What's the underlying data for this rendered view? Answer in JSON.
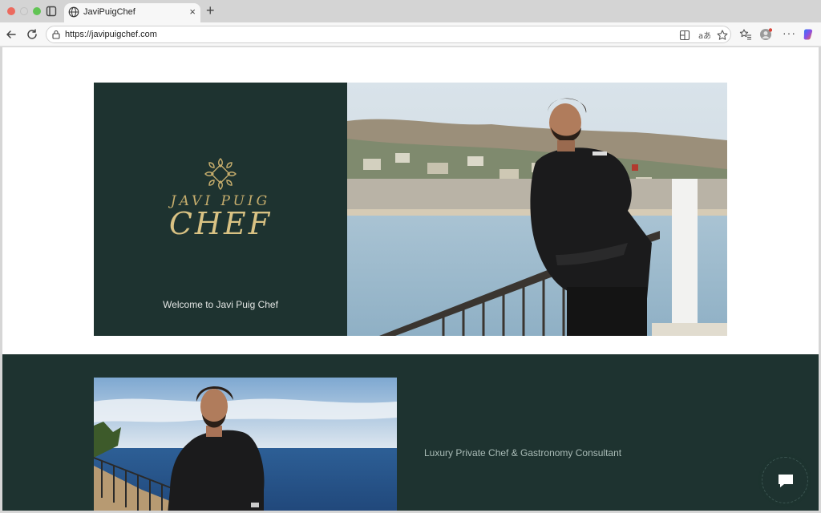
{
  "browser": {
    "tab_title": "JaviPuigChef",
    "url": "https://javipuigchef.com",
    "close_glyph": "×",
    "newtab_glyph": "+",
    "more_glyph": "···"
  },
  "hero": {
    "logo_line1": "JAVI PUIG",
    "logo_line2": "CHEF",
    "welcome": "Welcome to Javi Puig Chef"
  },
  "about": {
    "tagline": "Luxury Private Chef & Gastronomy Consultant"
  },
  "colors": {
    "brand_green": "#1e3330",
    "gold": "#c7ae6d"
  },
  "icons": [
    "globe-icon",
    "back-icon",
    "reload-icon",
    "lock-icon",
    "split-screen-icon",
    "translate-icon",
    "star-icon",
    "favorites-icon",
    "profile-icon",
    "copilot-icon",
    "chat-icon"
  ]
}
